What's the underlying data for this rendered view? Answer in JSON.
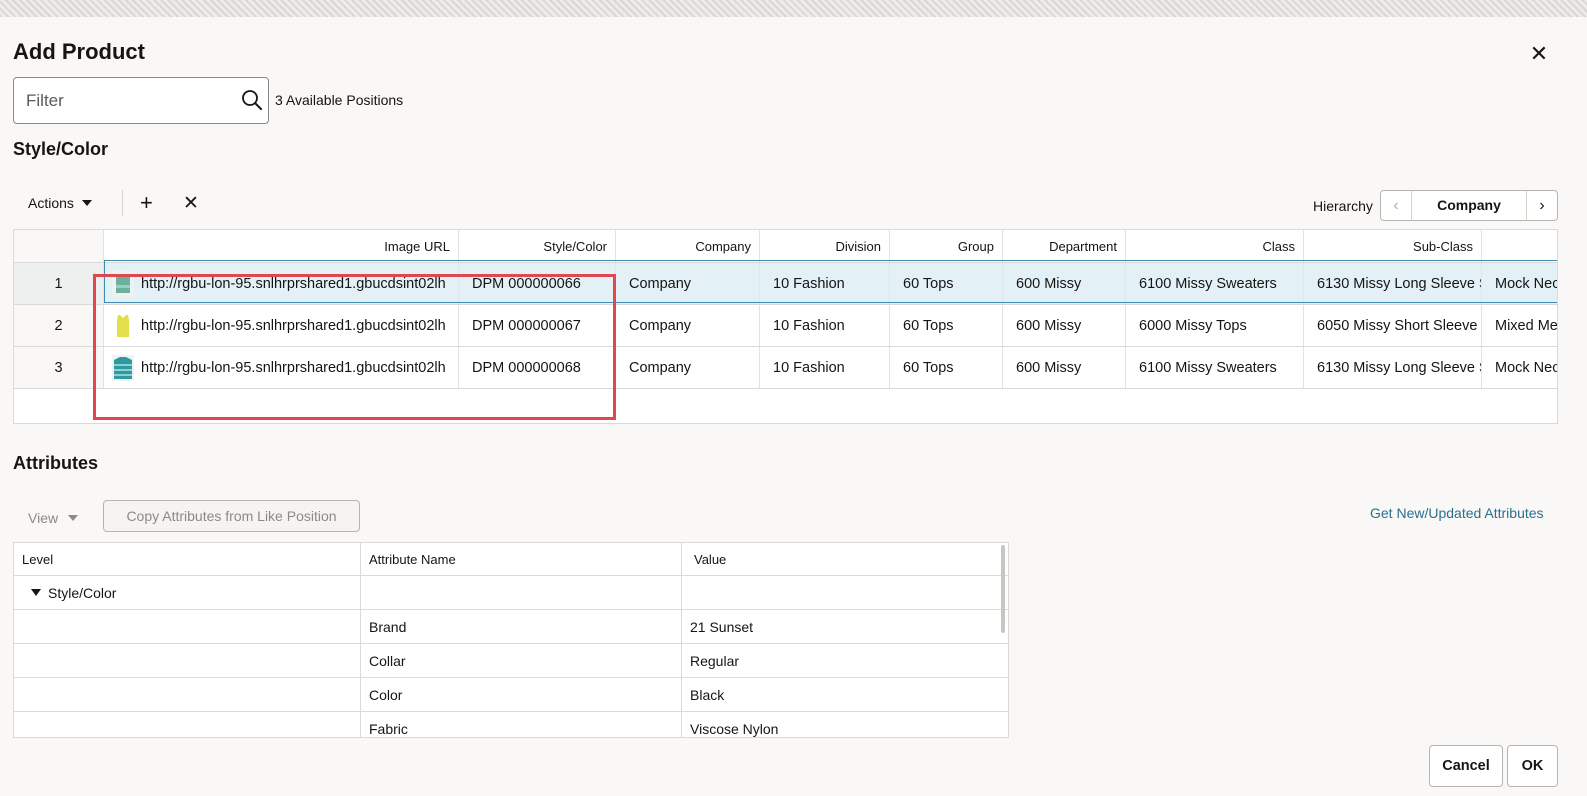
{
  "dialog": {
    "title": "Add Product",
    "close_icon": "close-icon"
  },
  "filter": {
    "placeholder": "Filter",
    "value": "",
    "available": "3 Available Positions"
  },
  "style_color": {
    "section_title": "Style/Color",
    "toolbar": {
      "actions_label": "Actions",
      "add_icon": "plus-icon",
      "remove_icon": "close-icon",
      "hierarchy_label": "Hierarchy",
      "hierarchy_value": "Company"
    },
    "columns": [
      "Image URL",
      "Style/Color",
      "Company",
      "Division",
      "Group",
      "Department",
      "Class",
      "Sub-Class",
      ""
    ],
    "rows": [
      {
        "num": "1",
        "thumb_color": "#6bb0a0",
        "url": "http://rgbu-lon-95.snlhrprshared1.gbucdsint02lh",
        "style_color": "DPM 000000066",
        "company": "Company",
        "division": "10 Fashion",
        "group": "60 Tops",
        "department": "600 Missy",
        "class": "6100 Missy Sweaters",
        "subclass": "6130 Missy Long Sleeve S",
        "extra": "Mock Nec"
      },
      {
        "num": "2",
        "thumb_color": "#e2df4a",
        "url": "http://rgbu-lon-95.snlhrprshared1.gbucdsint02lh",
        "style_color": "DPM 000000067",
        "company": "Company",
        "division": "10 Fashion",
        "group": "60 Tops",
        "department": "600 Missy",
        "class": "6000 Missy Tops",
        "subclass": "6050 Missy Short Sleeve",
        "extra": "Mixed Me"
      },
      {
        "num": "3",
        "thumb_color": "#2e9aa0",
        "url": "http://rgbu-lon-95.snlhrprshared1.gbucdsint02lh",
        "style_color": "DPM 000000068",
        "company": "Company",
        "division": "10 Fashion",
        "group": "60 Tops",
        "department": "600 Missy",
        "class": "6100 Missy Sweaters",
        "subclass": "6130 Missy Long Sleeve S",
        "extra": "Mock Nec"
      }
    ],
    "selected_row": 1,
    "highlight_color": "#e1484d"
  },
  "attributes": {
    "section_title": "Attributes",
    "view_label": "View",
    "copy_label": "Copy Attributes from Like Position",
    "get_new_label": "Get New/Updated Attributes",
    "columns": [
      "Level",
      "Attribute Name",
      "Value"
    ],
    "group_label": "Style/Color",
    "rows": [
      {
        "name": "Brand",
        "value": "21 Sunset"
      },
      {
        "name": "Collar",
        "value": "Regular"
      },
      {
        "name": "Color",
        "value": "Black"
      },
      {
        "name": "Fabric",
        "value": "Viscose Nylon"
      }
    ]
  },
  "footer": {
    "cancel_label": "Cancel",
    "ok_label": "OK"
  }
}
